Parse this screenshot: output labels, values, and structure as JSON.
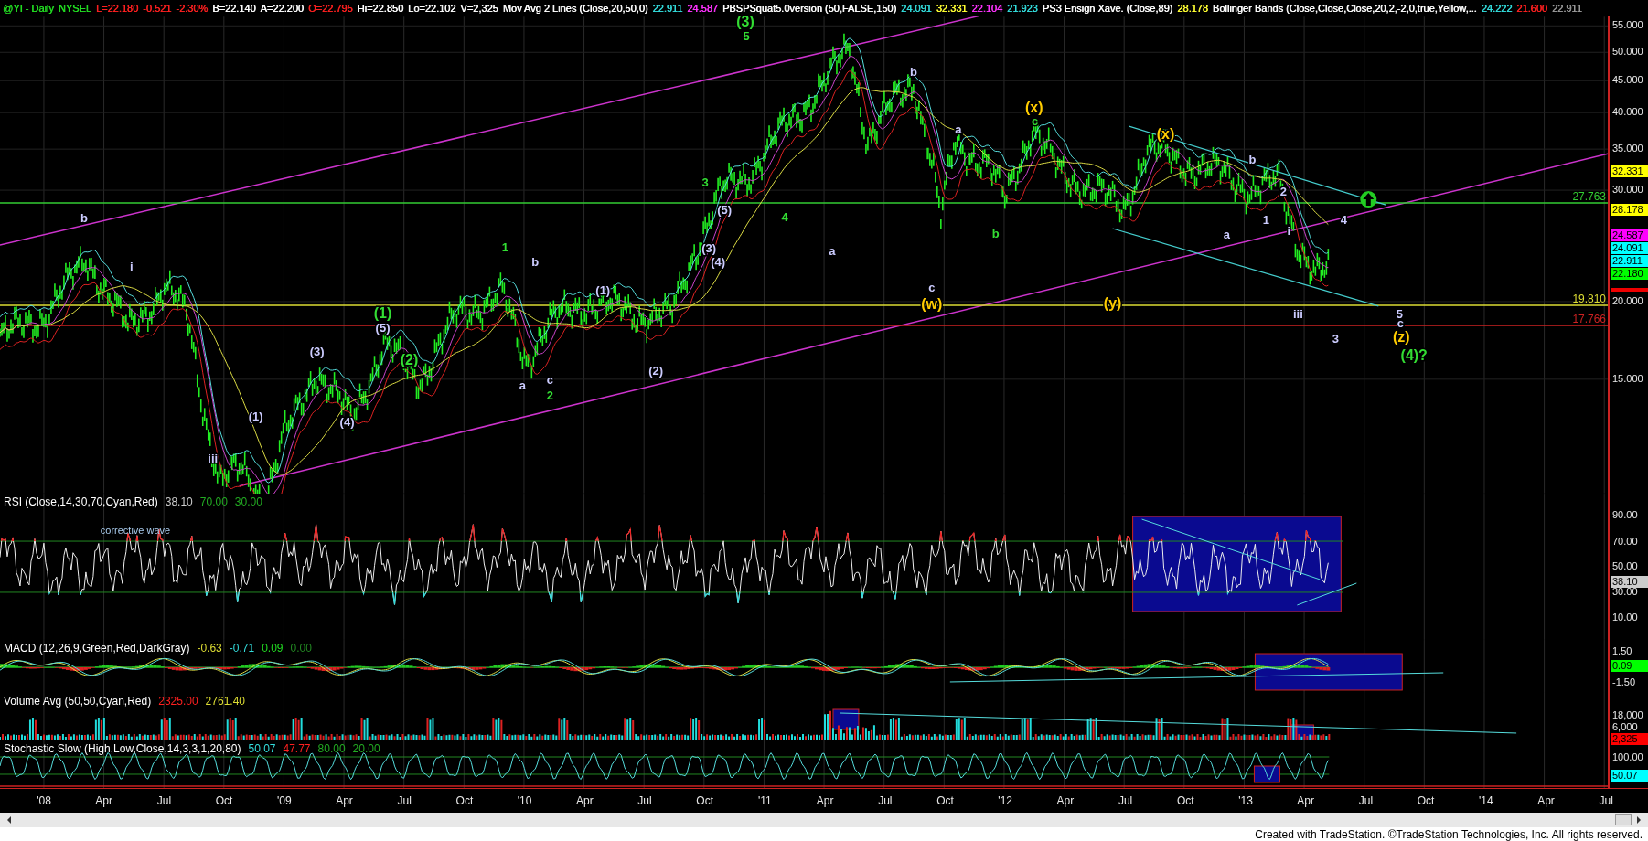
{
  "header": [
    {
      "text": "@YI - Daily",
      "color": "#22dd22"
    },
    {
      "text": "NYSEL",
      "color": "#22dd22"
    },
    {
      "text": "L=22.180",
      "color": "#ff2020"
    },
    {
      "text": "-0.521",
      "color": "#ff2020"
    },
    {
      "text": "-2.30%",
      "color": "#ff2020"
    },
    {
      "text": "B=22.140",
      "color": "#ffffff"
    },
    {
      "text": "A=22.200",
      "color": "#ffffff"
    },
    {
      "text": "O=22.795",
      "color": "#ff2020"
    },
    {
      "text": "Hi=22.850",
      "color": "#ffffff"
    },
    {
      "text": "Lo=22.102",
      "color": "#ffffff"
    },
    {
      "text": "V=2,325",
      "color": "#ffffff"
    },
    {
      "text": "Mov Avg 2 Lines (Close,20,50,0)",
      "color": "#ffffff"
    },
    {
      "text": "22.911",
      "color": "#33dddd"
    },
    {
      "text": "24.587",
      "color": "#ff33ff"
    },
    {
      "text": "PBSPSquat5.0version (50,FALSE,150)",
      "color": "#ffffff"
    },
    {
      "text": "24.091",
      "color": "#33dddd"
    },
    {
      "text": "32.331",
      "color": "#ffff33"
    },
    {
      "text": "22.104",
      "color": "#ff33ff"
    },
    {
      "text": "21.923",
      "color": "#33dddd"
    },
    {
      "text": "PS3 Ensign Xave. (Close,89)",
      "color": "#ffffff"
    },
    {
      "text": "28.178",
      "color": "#ffff33"
    },
    {
      "text": "Bollinger Bands (Close,Close,Close,20,2,-2,0,true,Yellow,...",
      "color": "#ffffff"
    },
    {
      "text": "24.222",
      "color": "#33dddd"
    },
    {
      "text": "21.600",
      "color": "#ff2020"
    },
    {
      "text": "22.911",
      "color": "#999999"
    }
  ],
  "price_pane": {
    "axis_ticks": [
      "55.000",
      "50.000",
      "45.000",
      "40.000",
      "35.000",
      "30.000",
      "20.000",
      "15.000"
    ],
    "badges": [
      {
        "text": "32.331",
        "color": "#ffff00"
      },
      {
        "text": "28.178",
        "color": "#ffff00"
      },
      {
        "text": "24.587",
        "color": "#ff00ff"
      },
      {
        "text": "24.091",
        "color": "#00ffff"
      },
      {
        "text": "22.911",
        "color": "#00ffff"
      },
      {
        "text": "22.180",
        "color": "#00ff00"
      }
    ],
    "levels": [
      {
        "text": "27.763",
        "color": "#33cc33"
      },
      {
        "text": "19.810",
        "color": "#dddd33"
      },
      {
        "text": "17.766",
        "color": "#cc2222"
      }
    ],
    "wave_labels": [
      {
        "text": "(3)",
        "color": "#33dd33",
        "kind": "major"
      },
      {
        "text": "5",
        "color": "#33dd33",
        "kind": "minor"
      },
      {
        "text": "b",
        "color": "#ccccff",
        "kind": "minor"
      },
      {
        "text": "i",
        "color": "#ccccff",
        "kind": "minor"
      },
      {
        "text": "(1)",
        "color": "#33dd33",
        "kind": "major"
      },
      {
        "text": "(5)",
        "color": "#ccccff",
        "kind": "minor"
      },
      {
        "text": "(3)",
        "color": "#ccccff",
        "kind": "minor"
      },
      {
        "text": "(2)",
        "color": "#33dd33",
        "kind": "major"
      },
      {
        "text": "(4)",
        "color": "#ccccff",
        "kind": "minor"
      },
      {
        "text": "(1)",
        "color": "#ccccff",
        "kind": "minor"
      },
      {
        "text": "iii",
        "color": "#ccccff",
        "kind": "minor"
      },
      {
        "text": "1",
        "color": "#33dd33",
        "kind": "minor"
      },
      {
        "text": "b",
        "color": "#ccccff",
        "kind": "minor"
      },
      {
        "text": "a",
        "color": "#ccccff",
        "kind": "minor"
      },
      {
        "text": "c",
        "color": "#ccccff",
        "kind": "minor"
      },
      {
        "text": "2",
        "color": "#33dd33",
        "kind": "minor"
      },
      {
        "text": "(1)",
        "color": "#ccccff",
        "kind": "minor"
      },
      {
        "text": "(2)",
        "color": "#ccccff",
        "kind": "minor"
      },
      {
        "text": "3",
        "color": "#33dd33",
        "kind": "minor"
      },
      {
        "text": "(5)",
        "color": "#ccccff",
        "kind": "minor"
      },
      {
        "text": "(3)",
        "color": "#ccccff",
        "kind": "minor"
      },
      {
        "text": "(4)",
        "color": "#ccccff",
        "kind": "minor"
      },
      {
        "text": "4",
        "color": "#33dd33",
        "kind": "minor"
      },
      {
        "text": "a",
        "color": "#ccccff",
        "kind": "minor"
      },
      {
        "text": "b",
        "color": "#ccccff",
        "kind": "minor"
      },
      {
        "text": "c",
        "color": "#ccccff",
        "kind": "minor"
      },
      {
        "text": "(w)",
        "color": "#ffcc00",
        "kind": "major"
      },
      {
        "text": "a",
        "color": "#ccccff",
        "kind": "minor"
      },
      {
        "text": "b",
        "color": "#33dd33",
        "kind": "minor"
      },
      {
        "text": "(x)",
        "color": "#ffcc00",
        "kind": "major"
      },
      {
        "text": "c",
        "color": "#33dd33",
        "kind": "minor"
      },
      {
        "text": "(y)",
        "color": "#ffcc00",
        "kind": "major"
      },
      {
        "text": "(x)",
        "color": "#ffcc00",
        "kind": "major"
      },
      {
        "text": "a",
        "color": "#ccccff",
        "kind": "minor"
      },
      {
        "text": "b",
        "color": "#ccccff",
        "kind": "minor"
      },
      {
        "text": "2",
        "color": "#ccccff",
        "kind": "minor"
      },
      {
        "text": "1",
        "color": "#ccccff",
        "kind": "minor"
      },
      {
        "text": "i",
        "color": "#ccccff",
        "kind": "minor"
      },
      {
        "text": "iii",
        "color": "#ccccff",
        "kind": "minor"
      },
      {
        "text": "4",
        "color": "#ccccff",
        "kind": "minor"
      },
      {
        "text": "3",
        "color": "#ccccff",
        "kind": "minor"
      },
      {
        "text": "5",
        "color": "#ccccff",
        "kind": "minor"
      },
      {
        "text": "c",
        "color": "#ccccff",
        "kind": "minor"
      },
      {
        "text": "(z)",
        "color": "#ffcc00",
        "kind": "major"
      },
      {
        "text": "(4)?",
        "color": "#33dd33",
        "kind": "major"
      }
    ]
  },
  "rsi_pane": {
    "title": "RSI (Close,14,30,70,Cyan,Red)",
    "values": [
      {
        "text": "38.10",
        "color": "#cccccc"
      },
      {
        "text": "70.00",
        "color": "#22aa22"
      },
      {
        "text": "30.00",
        "color": "#22aa22"
      }
    ],
    "note": "corrective wave",
    "axis_ticks": [
      "90.00",
      "70.00",
      "50.00",
      "30.00",
      "10.00"
    ],
    "badge": {
      "text": "38.10",
      "color": "#cccccc"
    }
  },
  "macd_pane": {
    "title": "MACD (12,26,9,Green,Red,DarkGray)",
    "values": [
      {
        "text": "-0.63",
        "color": "#dddd33"
      },
      {
        "text": "-0.71",
        "color": "#33dddd"
      },
      {
        "text": "0.09",
        "color": "#22dd22"
      },
      {
        "text": "0.00",
        "color": "#228822"
      }
    ],
    "axis_ticks": [
      "1.50",
      "-1.50"
    ],
    "badge": {
      "text": "0.09",
      "color": "#00ff00"
    }
  },
  "volume_pane": {
    "title": "Volume Avg (50,50,Cyan,Red)",
    "values": [
      {
        "text": "2325.00",
        "color": "#ff2020"
      },
      {
        "text": "2761.40",
        "color": "#dddd33"
      }
    ],
    "axis_ticks": [
      "18,000",
      "6,000"
    ],
    "badge": {
      "text": "2,325",
      "color": "#ff0000"
    }
  },
  "stochastic_pane": {
    "title": "Stochastic Slow (High,Low,Close,14,3,3,1,20,80)",
    "values": [
      {
        "text": "50.07",
        "color": "#33dddd"
      },
      {
        "text": "47.77",
        "color": "#ff2020"
      },
      {
        "text": "80.00",
        "color": "#22aa22"
      },
      {
        "text": "20.00",
        "color": "#22aa22"
      }
    ],
    "axis_ticks": [
      "100.00"
    ],
    "badge": {
      "text": "50.07",
      "color": "#00ffff"
    }
  },
  "x_axis": [
    "'08",
    "Apr",
    "Jul",
    "Oct",
    "'09",
    "Apr",
    "Jul",
    "Oct",
    "'10",
    "Apr",
    "Jul",
    "Oct",
    "'11",
    "Apr",
    "Jul",
    "Oct",
    "'12",
    "Apr",
    "Jul",
    "Oct",
    "'13",
    "Apr",
    "Jul",
    "Oct",
    "'14",
    "Apr",
    "Jul"
  ],
  "footer": "Created with TradeStation. ©TradeStation Technologies, Inc. All rights reserved."
}
